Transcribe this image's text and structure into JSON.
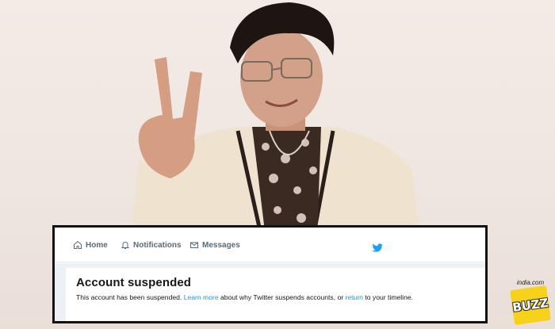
{
  "twitter": {
    "nav": {
      "home": "Home",
      "notifications": "Notifications",
      "messages": "Messages"
    },
    "notice": {
      "title": "Account suspended",
      "text_before": "This account has been suspended. ",
      "learn_more": "Learn more",
      "text_middle": " about why Twitter suspends accounts, or ",
      "return_link": "return",
      "text_after": " to your timeline."
    },
    "colors": {
      "link": "#1b95e0",
      "bird": "#1da1f2",
      "nav_text": "#5a6a78"
    }
  },
  "logo": {
    "top_text": "india.com",
    "badge_text": "BUZZ",
    "color": "#f6d21a"
  },
  "icons": [
    "home-icon",
    "bell-icon",
    "mail-icon",
    "twitter-bird-icon"
  ]
}
